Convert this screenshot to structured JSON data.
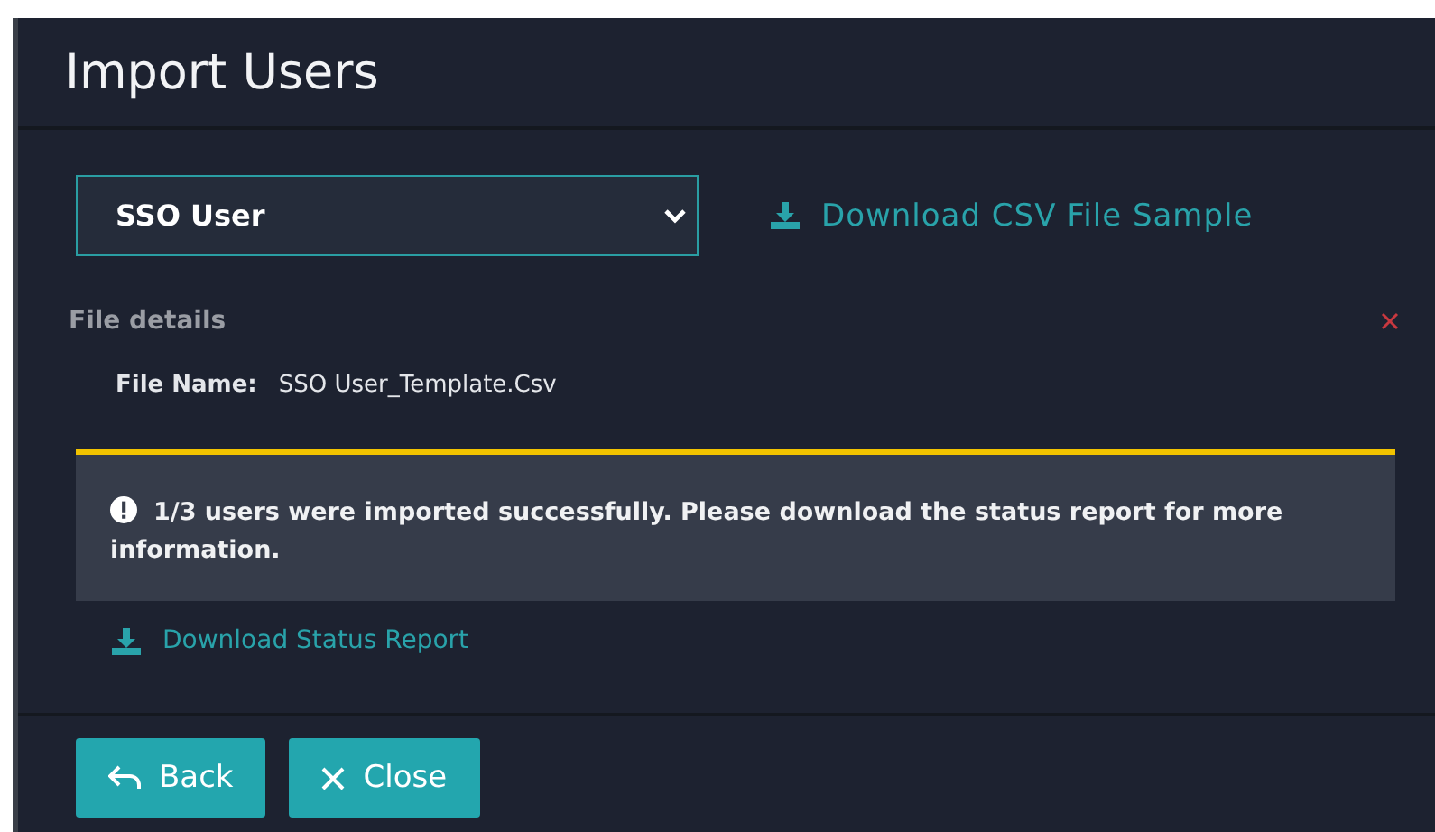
{
  "dialog": {
    "title": "Import Users"
  },
  "user_type_select": {
    "value": "SSO User"
  },
  "sample_link": {
    "label": "Download CSV File Sample"
  },
  "file_details": {
    "heading": "File details",
    "file_name_label": "File Name:",
    "file_name": "SSO User_Template.Csv"
  },
  "alert": {
    "kind": "warning",
    "message": "1/3 users were imported successfully. Please download the status report for more information."
  },
  "report_link": {
    "label": "Download Status Report"
  },
  "buttons": [
    {
      "kind": "back",
      "label": "Back"
    },
    {
      "kind": "close",
      "label": "Close"
    }
  ]
}
